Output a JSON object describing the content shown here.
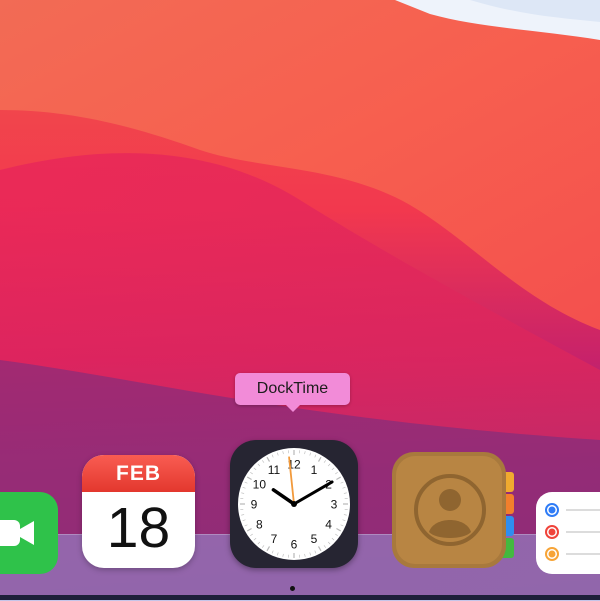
{
  "tooltip": {
    "label": "DockTime"
  },
  "dock": {
    "calendar": {
      "month": "FEB",
      "day": "18"
    },
    "clock": {
      "numbers": [
        "12",
        "1",
        "2",
        "3",
        "4",
        "5",
        "6",
        "7",
        "8",
        "9",
        "10",
        "11"
      ],
      "time": {
        "hours": 10,
        "minutes": 9,
        "seconds": 59
      }
    },
    "apps": [
      "facetime",
      "calendar",
      "docktime",
      "contacts",
      "reminders"
    ],
    "reminder_dot_colors": [
      "#2f7cf6",
      "#f0433a",
      "#f7a437"
    ]
  },
  "colors": {
    "accent": "#f28bd8"
  }
}
